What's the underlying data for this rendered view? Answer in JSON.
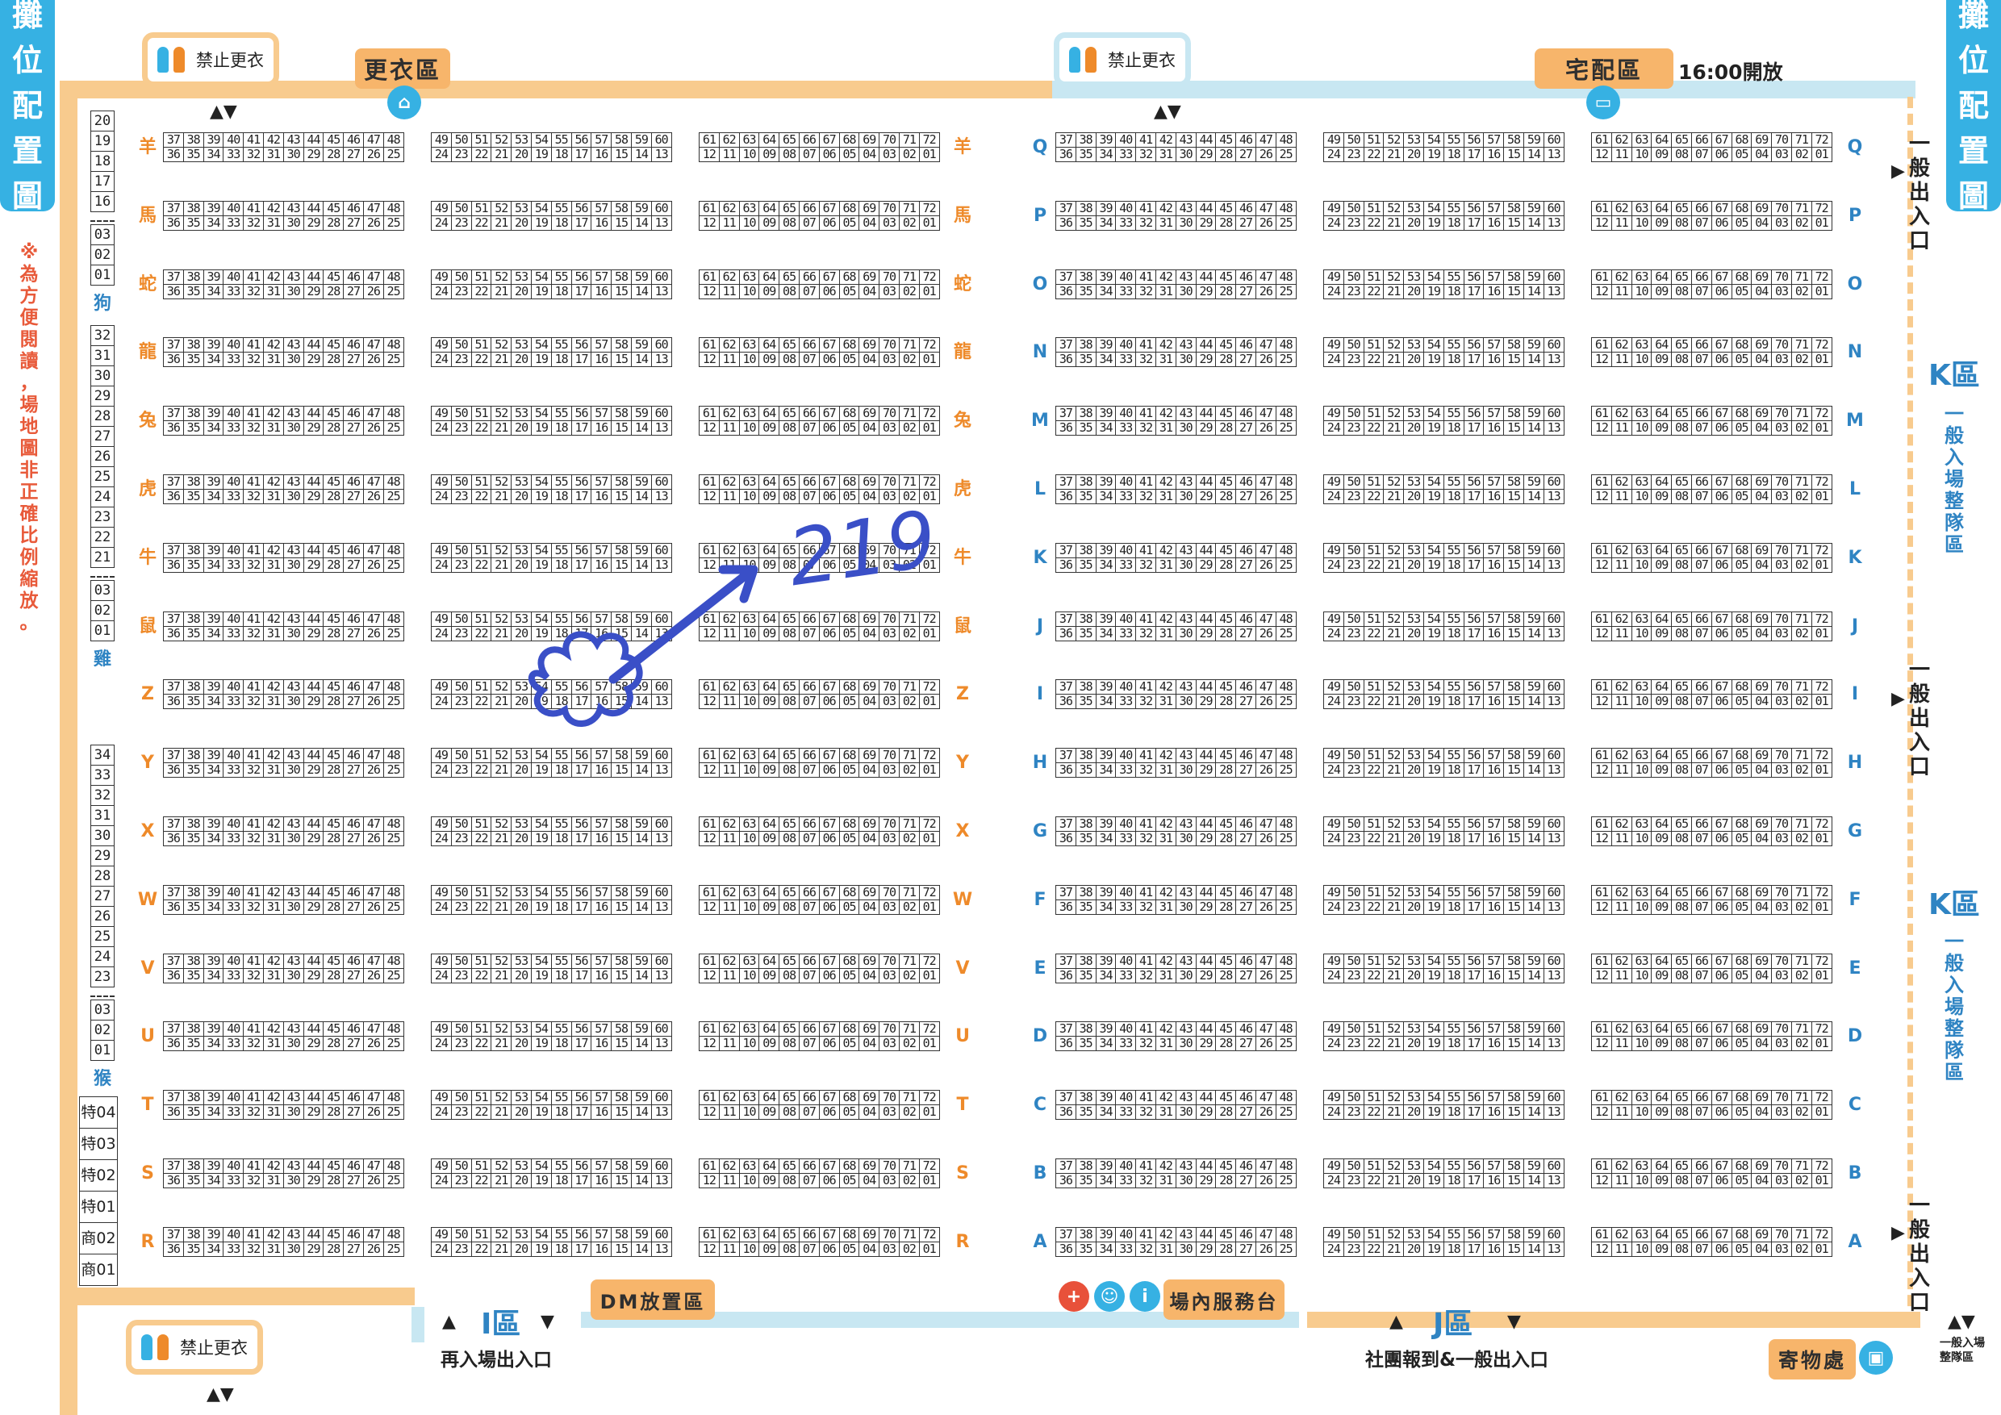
{
  "title_chars": [
    "攤",
    "位",
    "配",
    "置",
    "圖"
  ],
  "note_chars": [
    "※",
    "為",
    "方",
    "便",
    "閱",
    "讀",
    "，",
    "場",
    "地",
    "圖",
    "非",
    "正",
    "確",
    "比",
    "例",
    "縮",
    "放",
    "。"
  ],
  "top": {
    "no_change": "禁止更衣",
    "changing_area": "更衣區",
    "delivery_area": "宅配區",
    "delivery_open": "16:00開放"
  },
  "bottom": {
    "no_change": "禁止更衣",
    "zone_i": "I區",
    "zone_i_sub": "再入場出入口",
    "dm_area": "DM放置區",
    "service_desk": "場內服務台",
    "zone_j": "J區",
    "zone_j_sub": "社團報到&一般出入口",
    "locker": "寄物處",
    "queue_entry": "一般入場",
    "queue_area": "整隊區"
  },
  "right_side": {
    "exit": [
      "一",
      "般",
      "出",
      "入",
      "口"
    ],
    "k_zone": "K區",
    "k_zone_sub": [
      "一",
      "般",
      "入",
      "場",
      "整",
      "隊",
      "區"
    ]
  },
  "left_rows": [
    "羊",
    "馬",
    "蛇",
    "龍",
    "兔",
    "虎",
    "牛",
    "鼠",
    "Z",
    "Y",
    "X",
    "W",
    "V",
    "U",
    "T",
    "S",
    "R"
  ],
  "right_rows": [
    "Q",
    "P",
    "O",
    "N",
    "M",
    "L",
    "K",
    "J",
    "I",
    "H",
    "G",
    "F",
    "E",
    "D",
    "C",
    "B",
    "A"
  ],
  "block_numbers": {
    "a_top": [
      "37",
      "38",
      "39",
      "40",
      "41",
      "42",
      "43",
      "44",
      "45",
      "46",
      "47",
      "48"
    ],
    "a_bot": [
      "36",
      "35",
      "34",
      "33",
      "32",
      "31",
      "30",
      "29",
      "28",
      "27",
      "26",
      "25"
    ],
    "b_top": [
      "49",
      "50",
      "51",
      "52",
      "53",
      "54",
      "55",
      "56",
      "57",
      "58",
      "59",
      "60"
    ],
    "b_bot": [
      "24",
      "23",
      "22",
      "21",
      "20",
      "19",
      "18",
      "17",
      "16",
      "15",
      "14",
      "13"
    ],
    "c_top": [
      "61",
      "62",
      "63",
      "64",
      "65",
      "66",
      "67",
      "68",
      "69",
      "70",
      "71",
      "72"
    ],
    "c_bot": [
      "12",
      "11",
      "10",
      "09",
      "08",
      "07",
      "06",
      "05",
      "04",
      "03",
      "02",
      "01"
    ]
  },
  "left_stacks": {
    "dog_top": [
      "20",
      "19",
      "18",
      "17",
      "16"
    ],
    "dog_bot": [
      "03",
      "02",
      "01"
    ],
    "dog_label": "狗",
    "rooster_top": [
      "32",
      "31",
      "30",
      "29",
      "28",
      "27",
      "26",
      "25",
      "24",
      "23",
      "22",
      "21"
    ],
    "rooster_bot": [
      "03",
      "02",
      "01"
    ],
    "rooster_label": "雞",
    "monkey_top": [
      "34",
      "33",
      "32",
      "31",
      "30",
      "29",
      "28",
      "27",
      "26",
      "25",
      "24",
      "23"
    ],
    "monkey_bot": [
      "03",
      "02",
      "01"
    ],
    "monkey_label": "猴",
    "special": [
      "特04",
      "特03",
      "特02",
      "特01",
      "商02",
      "商01"
    ]
  },
  "annotation": "219",
  "colors": {
    "accent_blue": "#36b1e3",
    "orange_corridor": "#f8cb8e",
    "blue_corridor": "#c8e7f2",
    "ink": "#3a4fc7"
  }
}
